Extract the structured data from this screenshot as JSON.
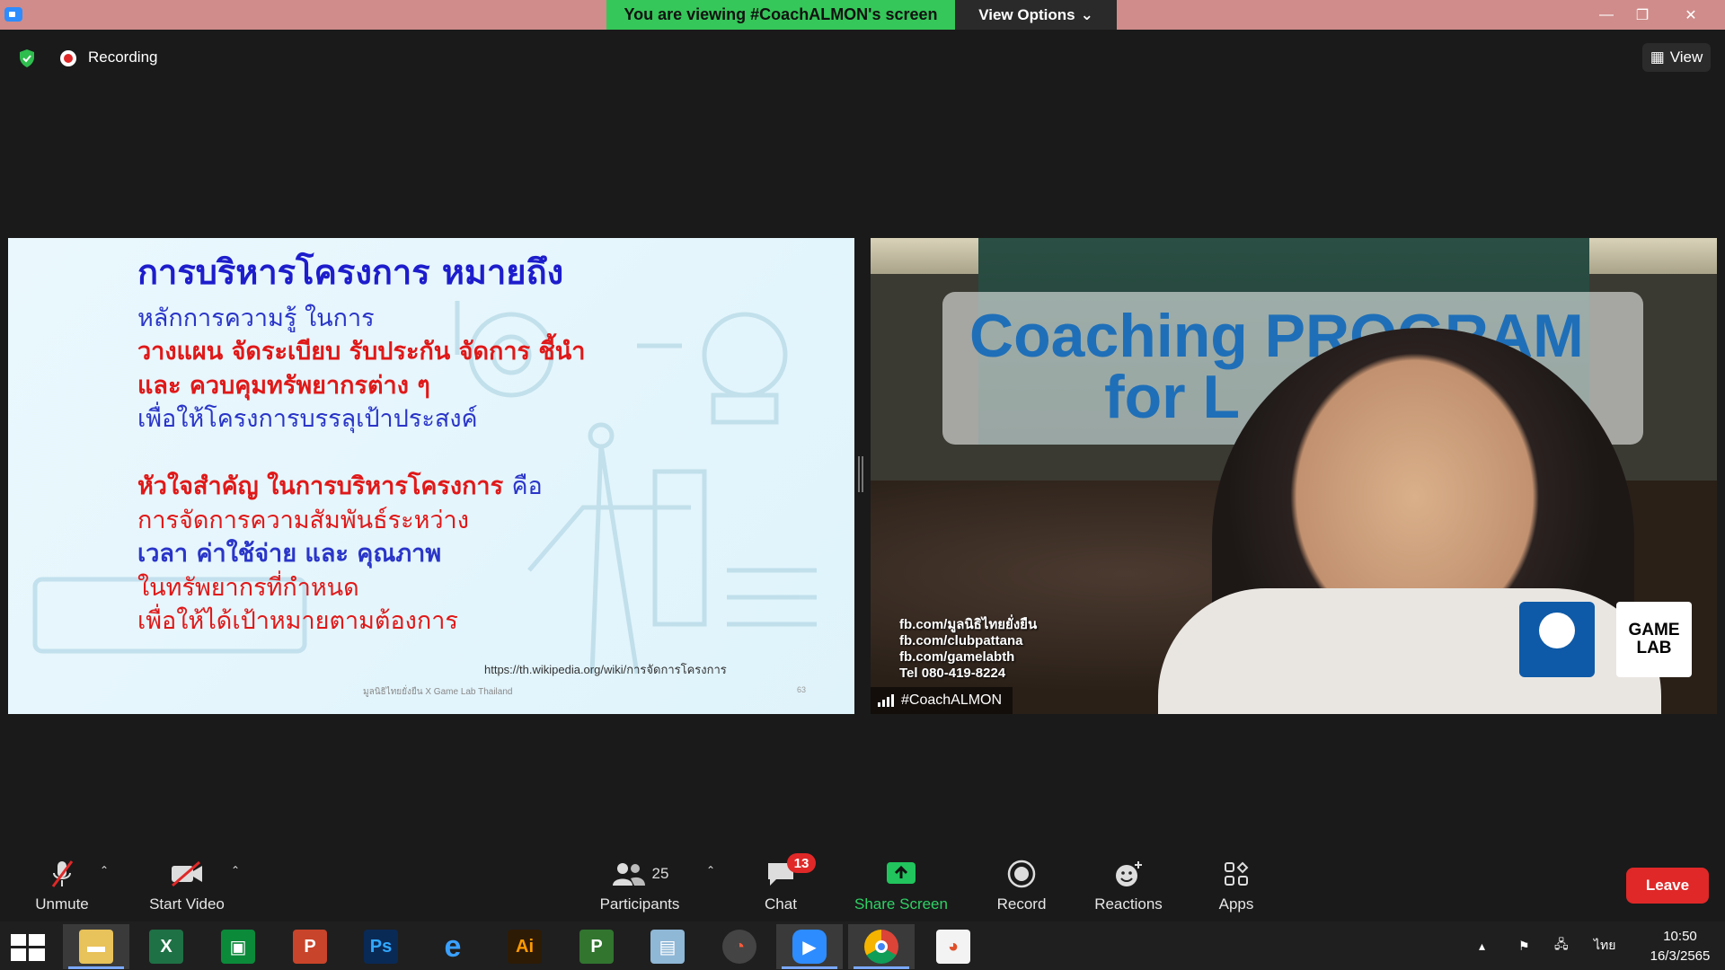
{
  "titlebar": {
    "banner": "You are viewing #CoachALMON's screen",
    "view_options": "View Options",
    "minimize": "—",
    "restore": "❐",
    "close": "✕"
  },
  "topbar": {
    "recording_label": "Recording",
    "view_label": "View"
  },
  "slide": {
    "title": "การบริหารโครงการ หมายถึง",
    "lines": [
      "หลักการความรู้ ในการ",
      "วางแผน จัดระเบียบ รับประกัน จัดการ ชี้นำ",
      "และ ควบคุมทรัพยากรต่าง ๆ",
      "เพื่อให้โครงการบรรลุเป้าประสงค์",
      "หัวใจสำคัญ ในการบริหารโครงการ",
      "คือ",
      "การจัดการความสัมพันธ์ระหว่าง",
      "เวลา ค่าใช้จ่าย และ คุณภาพ",
      "ในทรัพยากรที่กำหนด",
      "เพื่อให้ได้เป้าหมายตามต้องการ"
    ],
    "link": "https://th.wikipedia.org/wiki/การจัดการโครงการ",
    "footer": "มูลนิธิไทยยั่งยืน X Game Lab Thailand",
    "page": "63"
  },
  "video": {
    "brand_line1": "Coaching PROGRAM",
    "brand_line2": "for L",
    "contacts": [
      "fb.com/มูลนิธิไทยยั่งยืน",
      "fb.com/clubpattana",
      "fb.com/gamelabth",
      "Tel 080-419-8224"
    ],
    "logo2_text": "GAME LAB",
    "participant_name": "#CoachALMON"
  },
  "toolbar": {
    "unmute": "Unmute",
    "start_video": "Start Video",
    "participants_count": "25",
    "participants": "Participants",
    "chat": "Chat",
    "chat_badge": "13",
    "share_screen": "Share Screen",
    "record": "Record",
    "reactions": "Reactions",
    "apps": "Apps",
    "leave": "Leave"
  },
  "taskbar": {
    "apps": [
      "file-explorer",
      "excel",
      "store",
      "powerpoint",
      "photoshop",
      "internet-explorer",
      "illustrator",
      "project",
      "notepad",
      "photoscape",
      "zoom",
      "chrome",
      "paint"
    ],
    "language": "ไทย",
    "time": "10:50",
    "date": "16/3/2565"
  },
  "colors": {
    "titlebar": "#cf8c8a",
    "banner": "#35c759",
    "share_green": "#21c45d",
    "leave_red": "#e02828",
    "slide_title_blue": "#1d1dcc",
    "slide_red": "#e01818"
  }
}
